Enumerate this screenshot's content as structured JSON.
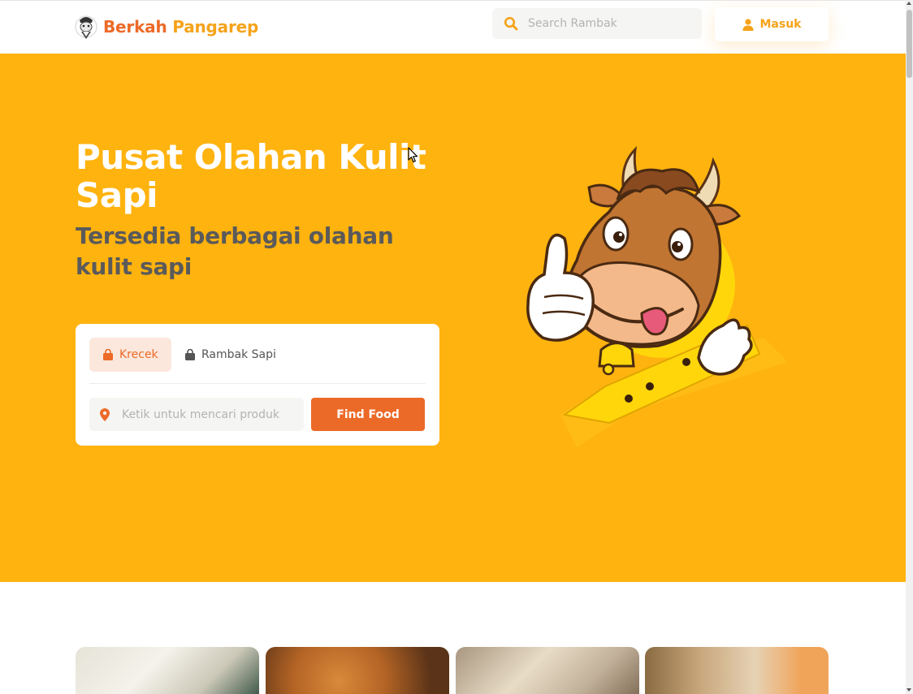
{
  "brand": {
    "name_part1": "Berkah",
    "name_part2": "Pangarep",
    "logo_icon": "mascot-logo-icon"
  },
  "navbar": {
    "search_placeholder": "Search Rambak",
    "search_icon": "search-icon",
    "login_label": "Masuk",
    "login_icon": "user-icon"
  },
  "hero": {
    "title": "Pusat Olahan Kulit Sapi",
    "subtitle": "Tersedia berbagai olahan kulit sapi",
    "tabs": [
      {
        "label": "Krecek",
        "icon": "shopping-bag-icon",
        "active": true
      },
      {
        "label": "Rambak Sapi",
        "icon": "shopping-bag-icon",
        "active": false
      }
    ],
    "location_placeholder": "Ketik untuk mencari produk",
    "location_icon": "map-pin-icon",
    "find_button": "Find Food",
    "mascot": "cow-mascot-thumbs-up"
  },
  "colors": {
    "hero_bg": "#ffb30f",
    "accent_orange": "#ec6a28",
    "accent_yellow": "#f5a31a",
    "subtitle_gray": "#5a5a5a"
  },
  "products": [
    {
      "image": "krupuk-photo"
    },
    {
      "image": "fried-skin-bowl-photo"
    },
    {
      "image": "rambak-squares-photo"
    },
    {
      "image": "packaged-product-photo"
    }
  ]
}
